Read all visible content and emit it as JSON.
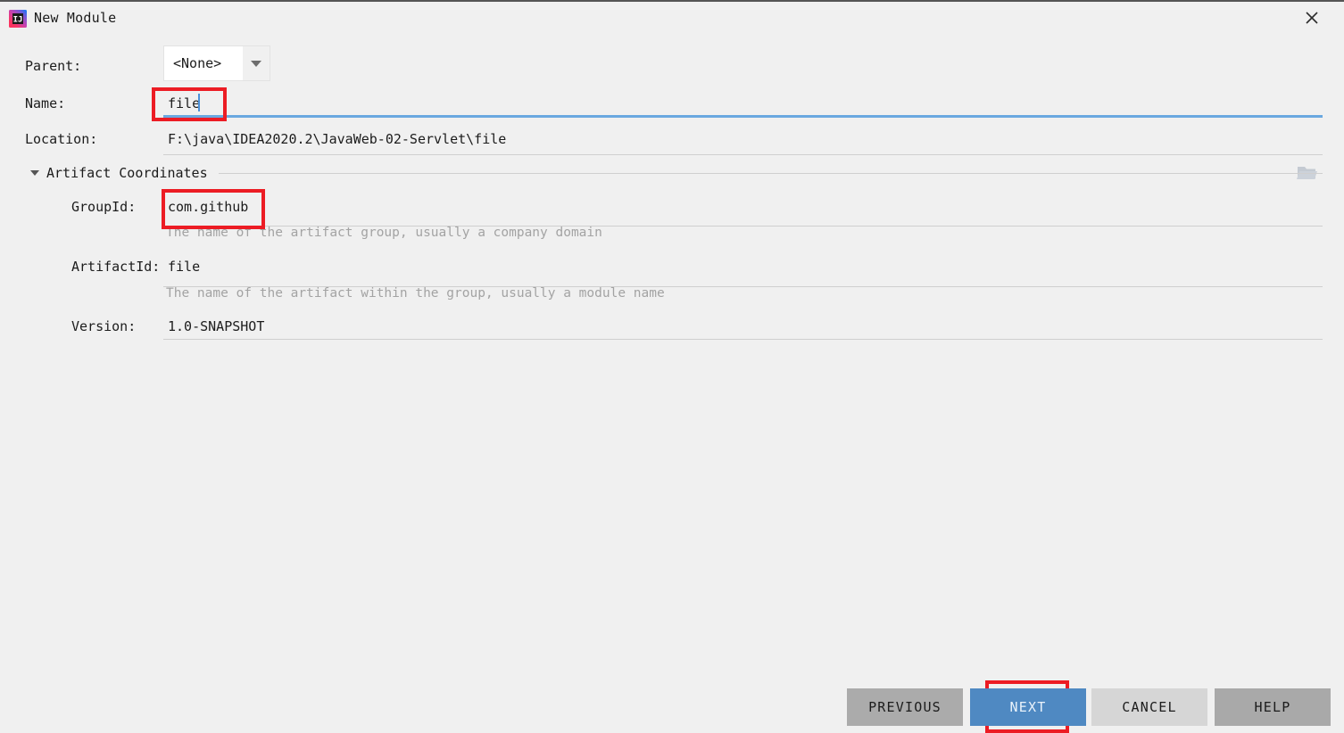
{
  "window": {
    "title": "New Module",
    "app_icon": "intellij-idea-icon",
    "close_icon": "close-icon"
  },
  "form": {
    "parent": {
      "label": "Parent:",
      "value": "<None>",
      "dropdown_icon": "chevron-down-icon"
    },
    "name": {
      "label": "Name:",
      "value": "file",
      "focused": true
    },
    "location": {
      "label": "Location:",
      "value": "F:\\java\\IDEA2020.2\\JavaWeb-02-Servlet\\file",
      "browse_icon": "folder-icon"
    },
    "artifact_coordinates": {
      "title": "Artifact Coordinates",
      "expanded": true,
      "collapse_icon": "caret-down-icon",
      "group_id": {
        "label": "GroupId:",
        "value": "com.github",
        "hint": "The name of the artifact group, usually a company domain"
      },
      "artifact_id": {
        "label": "ArtifactId:",
        "value": "file",
        "hint": "The name of the artifact within the group, usually a module name"
      },
      "version": {
        "label": "Version:",
        "value": "1.0-SNAPSHOT"
      }
    }
  },
  "footer": {
    "previous_label": "PREVIOUS",
    "next_label": "NEXT",
    "cancel_label": "CANCEL",
    "help_label": "HELP"
  },
  "annotations": {
    "color": "#ec1c24",
    "targets": [
      "name-field",
      "group-id-field",
      "next-button"
    ]
  },
  "colors": {
    "background": "#f0f0f0",
    "accent_blue": "#4f89c2",
    "focus_underline": "#6aa8e0",
    "hint_text": "#a3a3a3",
    "separator": "#cfcfcf"
  }
}
